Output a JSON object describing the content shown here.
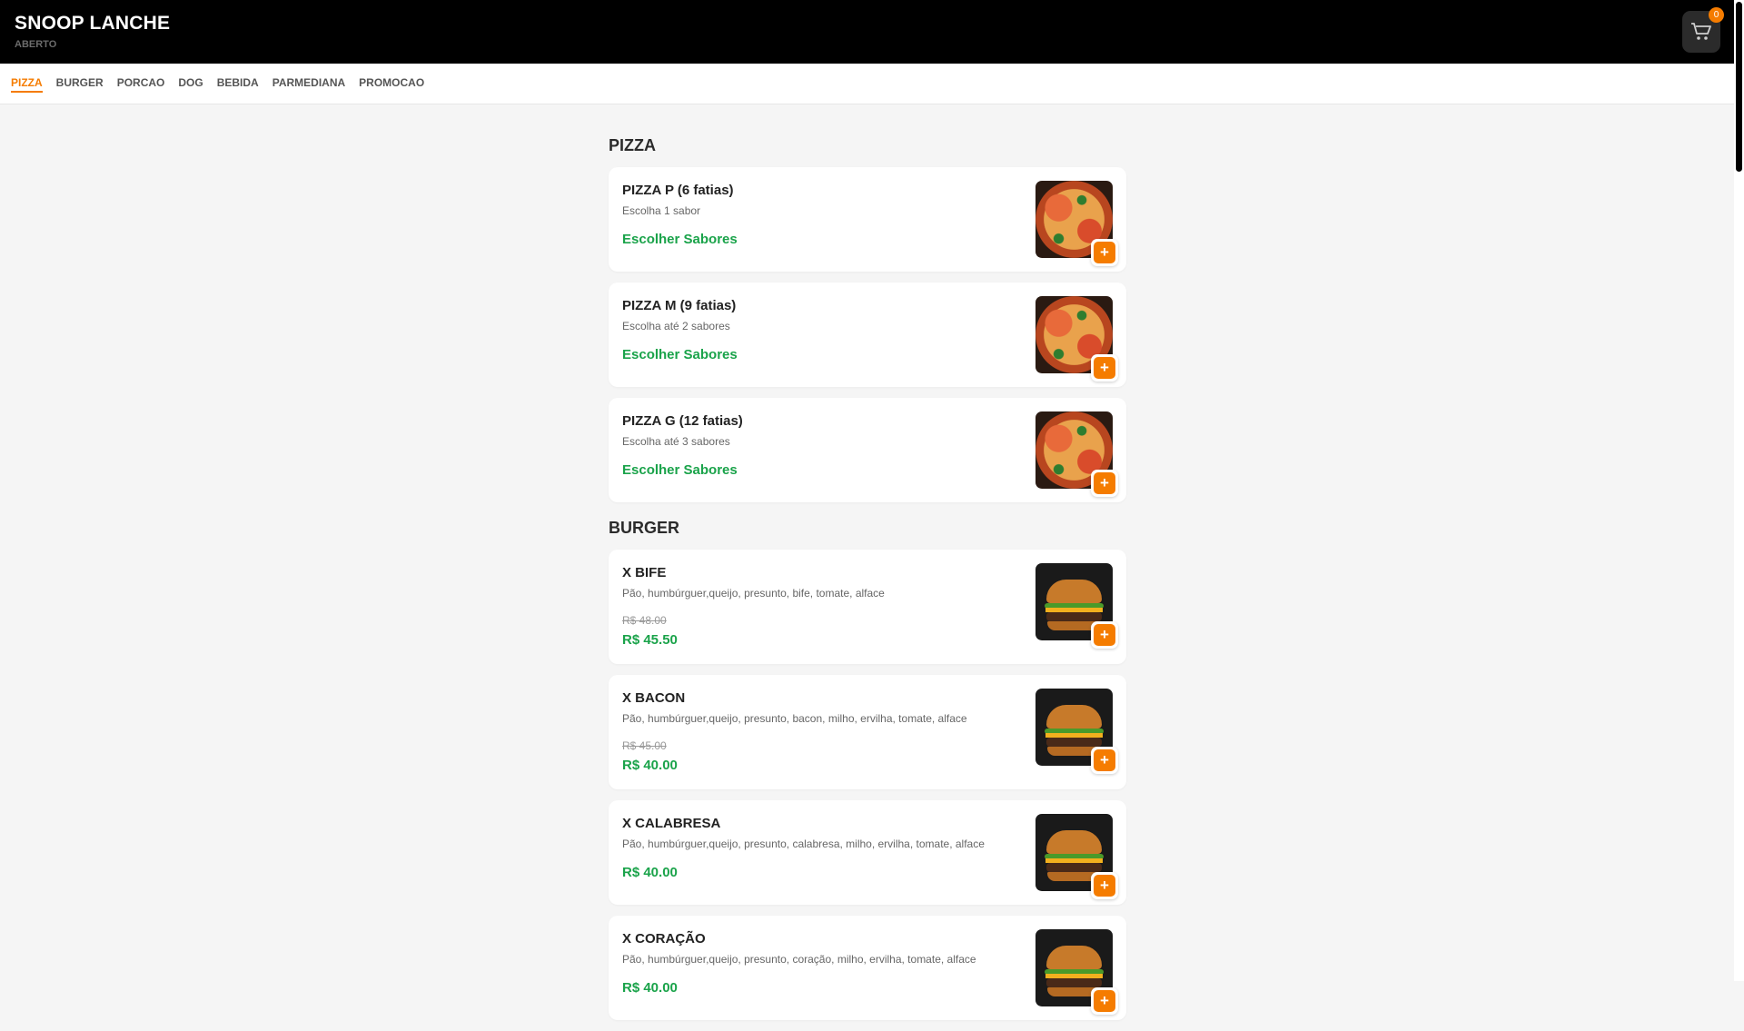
{
  "header": {
    "title": "SNOOP LANCHE",
    "status": "ABERTO",
    "cart_count": "0"
  },
  "categories": [
    "PIZZA",
    "BURGER",
    "PORCAO",
    "DOG",
    "BEBIDA",
    "PARMEDIANA",
    "PROMOCAO"
  ],
  "active_category": "PIZZA",
  "add_label": "+",
  "icons": {
    "cart": "cart-icon",
    "add": "plus-icon"
  },
  "colors": {
    "accent": "#f57c00",
    "price": "#1aa34a",
    "header": "#000000"
  },
  "sections": [
    {
      "title": "PIZZA",
      "items": [
        {
          "name": "PIZZA P (6 fatias)",
          "desc": "Escolha 1 sabor",
          "action": "Escolher Sabores"
        },
        {
          "name": "PIZZA M (9 fatias)",
          "desc": "Escolha até 2 sabores",
          "action": "Escolher Sabores"
        },
        {
          "name": "PIZZA G (12 fatias)",
          "desc": "Escolha até 3 sabores",
          "action": "Escolher Sabores"
        }
      ]
    },
    {
      "title": "BURGER",
      "items": [
        {
          "name": "X BIFE",
          "desc": "Pão, humbúrguer,queijo, presunto, bife, tomate, alface",
          "old_price": "R$ 48.00",
          "price": "R$ 45.50"
        },
        {
          "name": "X BACON",
          "desc": "Pão, humbúrguer,queijo, presunto, bacon, milho, ervilha, tomate, alface",
          "old_price": "R$ 45.00",
          "price": "R$ 40.00"
        },
        {
          "name": "X CALABRESA",
          "desc": "Pão, humbúrguer,queijo, presunto, calabresa, milho, ervilha, tomate, alface",
          "price": "R$ 40.00"
        },
        {
          "name": "X CORAÇÃO",
          "desc": "Pão, humbúrguer,queijo, presunto, coração, milho, ervilha, tomate, alface",
          "price": "R$ 40.00"
        }
      ]
    }
  ]
}
